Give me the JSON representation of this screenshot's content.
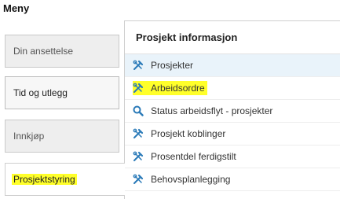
{
  "menu": {
    "title": "Meny"
  },
  "categories": [
    {
      "label": "Din ansettelse"
    },
    {
      "label": "Tid og utlegg"
    },
    {
      "label": "Innkjøp"
    },
    {
      "label": "Prosjektstyring"
    }
  ],
  "panel": {
    "title": "Prosjekt informasjon",
    "items": [
      {
        "label": "Prosjekter",
        "icon": "project-tools-icon"
      },
      {
        "label": "Arbeidsordre",
        "icon": "project-tools-icon"
      },
      {
        "label": "Status arbeidsflyt - prosjekter",
        "icon": "search-icon"
      },
      {
        "label": "Prosjekt koblinger",
        "icon": "project-tools-icon"
      },
      {
        "label": "Prosentdel ferdigstilt",
        "icon": "project-tools-icon"
      },
      {
        "label": "Behovsplanlegging",
        "icon": "project-tools-icon"
      }
    ]
  },
  "colors": {
    "highlight": "#ffff2a",
    "icon": "#2a7ab8",
    "row_hover": "#e9f3fa"
  }
}
